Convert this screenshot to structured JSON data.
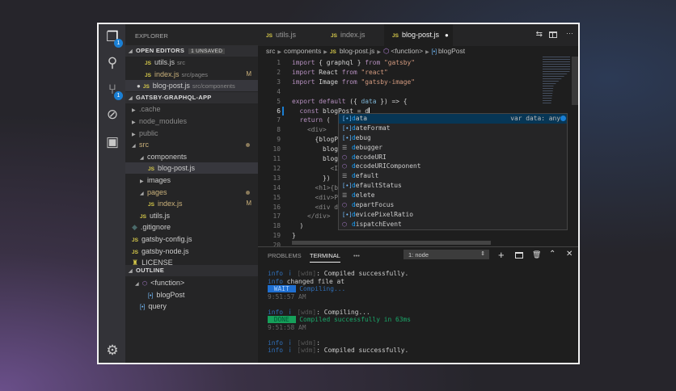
{
  "activity": [
    {
      "icon": "files-icon",
      "badge": "1"
    },
    {
      "icon": "search-icon"
    },
    {
      "icon": "source-control-icon",
      "badge": "1"
    },
    {
      "icon": "debug-icon"
    },
    {
      "icon": "extensions-icon"
    },
    {
      "icon": "gear-icon"
    }
  ],
  "sidebar": {
    "title": "EXPLORER",
    "open_editors": {
      "label": "OPEN EDITORS",
      "badge": "1 UNSAVED",
      "items": [
        {
          "name": "utils.js",
          "path": "src",
          "status": ""
        },
        {
          "name": "index.js",
          "path": "src/pages",
          "status": "M"
        },
        {
          "name": "blog-post.js",
          "path": "src/components",
          "status": "",
          "unsaved": true
        }
      ]
    },
    "project": {
      "label": "GATSBY-GRAPHQL-APP",
      "items": [
        {
          "name": ".cache",
          "type": "folder",
          "depth": 0,
          "expanded": false
        },
        {
          "name": "node_modules",
          "type": "folder",
          "depth": 0,
          "expanded": false
        },
        {
          "name": "public",
          "type": "folder",
          "depth": 0,
          "expanded": false
        },
        {
          "name": "src",
          "type": "folder",
          "depth": 0,
          "expanded": true,
          "modified": true
        },
        {
          "name": "components",
          "type": "folder",
          "depth": 1,
          "expanded": true
        },
        {
          "name": "blog-post.js",
          "type": "js",
          "depth": 2,
          "selected": true
        },
        {
          "name": "images",
          "type": "folder",
          "depth": 1,
          "expanded": false
        },
        {
          "name": "pages",
          "type": "folder",
          "depth": 1,
          "expanded": true,
          "modified": true
        },
        {
          "name": "index.js",
          "type": "js",
          "depth": 2,
          "status": "M"
        },
        {
          "name": "utils.js",
          "type": "js",
          "depth": 1
        },
        {
          "name": ".gitignore",
          "type": "file",
          "depth": 0
        },
        {
          "name": "gatsby-config.js",
          "type": "js",
          "depth": 0
        },
        {
          "name": "gatsby-node.js",
          "type": "js",
          "depth": 0
        },
        {
          "name": "LICENSE",
          "type": "license",
          "depth": 0
        }
      ]
    },
    "outline": {
      "label": "OUTLINE",
      "items": [
        {
          "name": "<function>",
          "icon": "function-icon",
          "depth": 0
        },
        {
          "name": "blogPost",
          "icon": "variable-icon",
          "depth": 1
        },
        {
          "name": "query",
          "icon": "variable-icon",
          "depth": 0
        }
      ]
    }
  },
  "editor": {
    "tabs": [
      {
        "label": "utils.js"
      },
      {
        "label": "index.js"
      },
      {
        "label": "blog-post.js",
        "active": true,
        "unsaved": true
      }
    ],
    "breadcrumb": [
      "src",
      "components",
      "blog-post.js",
      "<function>",
      "blogPost"
    ],
    "lines": [
      [
        [
          "import",
          "k"
        ],
        [
          " { graphql } ",
          ""
        ],
        [
          "from",
          "k"
        ],
        [
          " \"gatsby\"",
          "s"
        ]
      ],
      [
        [
          "import",
          "k"
        ],
        [
          " React ",
          ""
        ],
        [
          "from",
          "k"
        ],
        [
          " \"react\"",
          "s"
        ]
      ],
      [
        [
          "import",
          "k"
        ],
        [
          " Image ",
          ""
        ],
        [
          "from",
          "k"
        ],
        [
          " \"gatsby-image\"",
          "s"
        ]
      ],
      [],
      [
        [
          "export default",
          "k"
        ],
        [
          " ({ ",
          ""
        ],
        [
          "data",
          "t"
        ],
        [
          " }) => {",
          ""
        ]
      ],
      [
        [
          "  const",
          "k"
        ],
        [
          " blogPost = d",
          ""
        ]
      ],
      [
        [
          "  return",
          "k"
        ],
        [
          " (",
          ""
        ]
      ],
      [
        [
          "    <div>",
          "g"
        ]
      ],
      [
        [
          "      {blogP",
          ""
        ]
      ],
      [
        [
          "        blog",
          ""
        ]
      ],
      [
        [
          "        blog",
          ""
        ]
      ],
      [
        [
          "          <I",
          "g"
        ]
      ],
      [
        [
          "        })",
          ""
        ]
      ],
      [
        [
          "      <h1>{b",
          "g"
        ]
      ],
      [
        [
          "      <div>P",
          "g"
        ]
      ],
      [
        [
          "      <div d",
          "g"
        ]
      ],
      [
        [
          "    </div>",
          "g"
        ]
      ],
      [
        [
          "  )",
          ""
        ]
      ],
      [
        [
          "}",
          ""
        ]
      ],
      []
    ],
    "current_line": 6,
    "suggestions": [
      {
        "label": "data",
        "kind": "variable",
        "detail": "var data: any"
      },
      {
        "label": "dateFormat",
        "kind": "variable"
      },
      {
        "label": "debug",
        "kind": "variable"
      },
      {
        "label": "debugger",
        "kind": "keyword"
      },
      {
        "label": "decodeURI",
        "kind": "function"
      },
      {
        "label": "decodeURIComponent",
        "kind": "function"
      },
      {
        "label": "default",
        "kind": "keyword"
      },
      {
        "label": "defaultStatus",
        "kind": "variable"
      },
      {
        "label": "delete",
        "kind": "keyword"
      },
      {
        "label": "departFocus",
        "kind": "function"
      },
      {
        "label": "devicePixelRatio",
        "kind": "variable"
      },
      {
        "label": "dispatchEvent",
        "kind": "function"
      }
    ]
  },
  "panel": {
    "tabs": [
      "PROBLEMS",
      "TERMINAL"
    ],
    "active_tab": "TERMINAL",
    "more": "•••",
    "terminal_select": "1: node",
    "lines": [
      [
        [
          "info",
          "bl"
        ],
        [
          " ｉ ",
          "bl"
        ],
        [
          "[wdm]",
          "tg"
        ],
        [
          ": Compiled successfully.",
          ""
        ]
      ],
      [
        [
          "info",
          "bl"
        ],
        [
          " changed file at",
          ""
        ]
      ],
      [
        [
          " WAIT ",
          "wait"
        ],
        [
          " Compiling...",
          "bl"
        ]
      ],
      [
        [
          "9:51:57 AM",
          "ts"
        ]
      ],
      [],
      [
        [
          "info",
          "bl"
        ],
        [
          " ｉ ",
          "bl"
        ],
        [
          "[wdm]",
          "tg"
        ],
        [
          ": Compiling...",
          ""
        ]
      ],
      [
        [
          " DONE ",
          "done"
        ],
        [
          " Compiled successfully in 63ms",
          "gr"
        ]
      ],
      [
        [
          "9:51:58 AM",
          "ts"
        ]
      ],
      [],
      [
        [
          "info",
          "bl"
        ],
        [
          " ｉ ",
          "bl"
        ],
        [
          "[wdm]",
          "tg"
        ],
        [
          ":",
          ""
        ]
      ],
      [
        [
          "info",
          "bl"
        ],
        [
          " ｉ ",
          "bl"
        ],
        [
          "[wdm]",
          "tg"
        ],
        [
          ": Compiled successfully.",
          ""
        ]
      ]
    ]
  },
  "colors": {
    "accent": "#1a7fd4",
    "selection": "#073655",
    "js": "#d6c94a"
  }
}
